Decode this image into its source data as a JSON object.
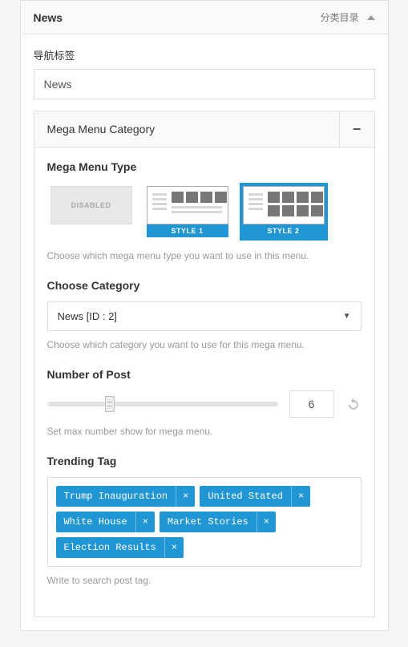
{
  "header": {
    "title": "News",
    "meta": "分类目录"
  },
  "nav_label": {
    "label": "导航标签",
    "value": "News"
  },
  "accordion": {
    "title": "Mega Menu Category",
    "toggle": "−"
  },
  "mega_type": {
    "title": "Mega Menu Type",
    "disabled": "DISABLED",
    "style1": "STYLE 1",
    "style2": "STYLE 2",
    "help": "Choose which mega menu type you want to use in this menu."
  },
  "category": {
    "title": "Choose Category",
    "value": "News  [ID : 2]",
    "caret": "▼",
    "help": "Choose which category you want to use for this mega menu."
  },
  "number_post": {
    "title": "Number of Post",
    "value": "6",
    "help": "Set max number show for mega menu."
  },
  "trending": {
    "title": "Trending Tag",
    "tags": [
      "Trump Inauguration",
      "United Stated",
      "White House",
      "Market Stories",
      "Election Results"
    ],
    "x": "×",
    "help": "Write to search post tag."
  }
}
